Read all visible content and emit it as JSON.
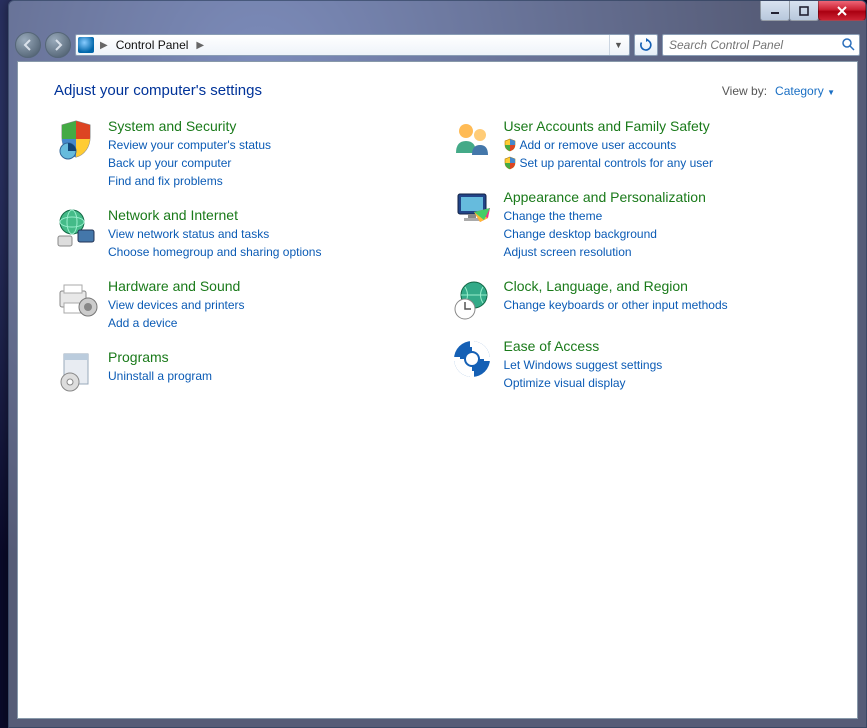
{
  "breadcrumb": {
    "root": "Control Panel"
  },
  "search": {
    "placeholder": "Search Control Panel"
  },
  "page": {
    "title": "Adjust your computer's settings",
    "viewby_label": "View by:",
    "viewby_value": "Category"
  },
  "left": [
    {
      "icon": "shield-pie-icon",
      "title": "System and Security",
      "links": [
        {
          "text": "Review your computer's status"
        },
        {
          "text": "Back up your computer"
        },
        {
          "text": "Find and fix problems"
        }
      ]
    },
    {
      "icon": "globe-network-icon",
      "title": "Network and Internet",
      "links": [
        {
          "text": "View network status and tasks"
        },
        {
          "text": "Choose homegroup and sharing options"
        }
      ]
    },
    {
      "icon": "printer-speaker-icon",
      "title": "Hardware and Sound",
      "links": [
        {
          "text": "View devices and printers"
        },
        {
          "text": "Add a device"
        }
      ]
    },
    {
      "icon": "box-disc-icon",
      "title": "Programs",
      "links": [
        {
          "text": "Uninstall a program"
        }
      ]
    }
  ],
  "right": [
    {
      "icon": "people-icon",
      "title": "User Accounts and Family Safety",
      "links": [
        {
          "text": "Add or remove user accounts",
          "shield": true
        },
        {
          "text": "Set up parental controls for any user",
          "shield": true
        }
      ]
    },
    {
      "icon": "monitor-paint-icon",
      "title": "Appearance and Personalization",
      "links": [
        {
          "text": "Change the theme"
        },
        {
          "text": "Change desktop background"
        },
        {
          "text": "Adjust screen resolution"
        }
      ]
    },
    {
      "icon": "globe-clock-icon",
      "title": "Clock, Language, and Region",
      "links": [
        {
          "text": "Change keyboards or other input methods"
        }
      ]
    },
    {
      "icon": "ease-access-icon",
      "title": "Ease of Access",
      "links": [
        {
          "text": "Let Windows suggest settings"
        },
        {
          "text": "Optimize visual display"
        }
      ]
    }
  ]
}
